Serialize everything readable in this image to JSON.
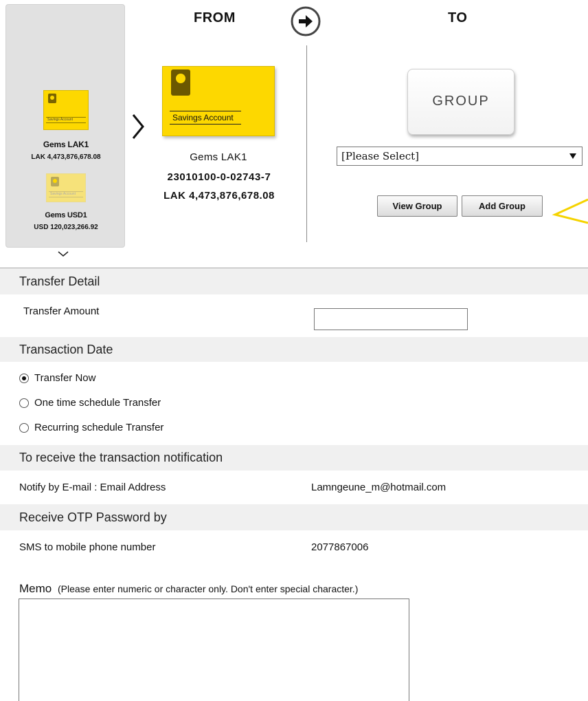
{
  "accounts": [
    {
      "card_label": "Savings Account",
      "name": "Gems LAK1",
      "balance": "LAK 4,473,876,678.08"
    },
    {
      "card_label": "Savings Account",
      "name": "Gems USD1",
      "balance": "USD 120,023,266.92"
    }
  ],
  "header": {
    "from": "FROM",
    "to": "TO"
  },
  "from_account": {
    "card_label": "Savings Account",
    "name": "Gems LAK1",
    "number": "23010100-0-02743-7",
    "balance": "LAK 4,473,876,678.08"
  },
  "to": {
    "group_tile": "GROUP",
    "select_value": "[Please Select]",
    "view_group_label": "View Group",
    "add_group_label": "Add Group"
  },
  "transfer_detail": {
    "heading": "Transfer Detail",
    "amount_label": "Transfer Amount",
    "amount_value": ""
  },
  "transaction_date": {
    "heading": "Transaction Date",
    "options": [
      {
        "label": "Transfer Now",
        "selected": true
      },
      {
        "label": "One time schedule Transfer",
        "selected": false
      },
      {
        "label": "Recurring schedule Transfer",
        "selected": false
      }
    ]
  },
  "notification": {
    "heading": "To receive the transaction notification",
    "label": "Notify by E-mail : Email Address",
    "email": "Lamngeune_m@hotmail.com"
  },
  "otp": {
    "heading": "Receive OTP Password by",
    "label": "SMS to mobile phone number",
    "phone": "2077867006"
  },
  "memo": {
    "label": "Memo",
    "hint": "(Please enter numeric or character only. Don't enter special character.)",
    "value": ""
  },
  "colors": {
    "card_yellow": "#fdd800",
    "band_gray": "#f0f0f0",
    "annotation_yellow": "#f5d300"
  }
}
